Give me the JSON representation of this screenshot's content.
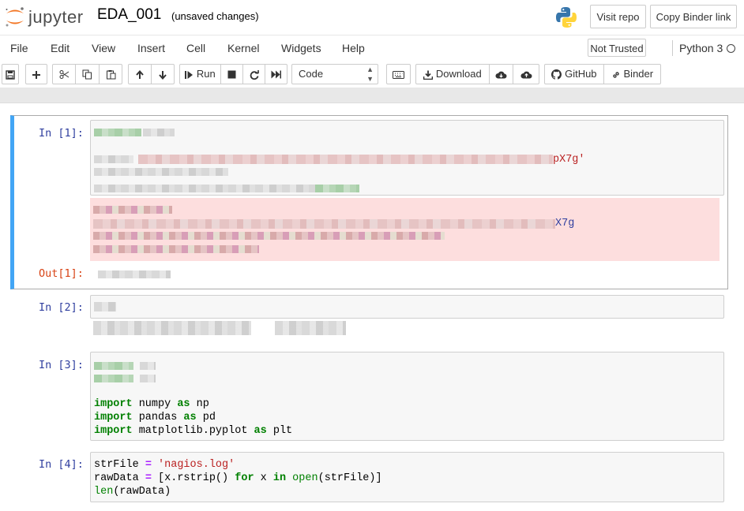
{
  "header": {
    "logo_text": "jupyter",
    "notebook_name": "EDA_001",
    "autosave_status": "(unsaved changes)",
    "visit_repo": "Visit repo",
    "copy_binder_link": "Copy Binder link"
  },
  "menubar": {
    "items": [
      "File",
      "Edit",
      "View",
      "Insert",
      "Cell",
      "Kernel",
      "Widgets",
      "Help"
    ],
    "trust_status": "Not Trusted",
    "kernel_name": "Python 3"
  },
  "toolbar": {
    "run_label": "Run",
    "cell_type": "Code",
    "download_label": "Download",
    "github_label": "GitHub",
    "binder_label": "Binder"
  },
  "cells": [
    {
      "prompt": "In [1]:",
      "output_prompt": "Out[1]:",
      "visible_fragment_1": "pX7g'",
      "visible_fragment_2": "X7g"
    },
    {
      "prompt": "In [2]:"
    },
    {
      "prompt": "In [3]:",
      "code": [
        {
          "kw": "import",
          "rest": " numpy ",
          "kw2": "as",
          "rest2": " np"
        },
        {
          "kw": "import",
          "rest": " pandas ",
          "kw2": "as",
          "rest2": " pd"
        },
        {
          "kw": "import",
          "rest": " matplotlib.pyplot ",
          "kw2": "as",
          "rest2": " plt"
        }
      ]
    },
    {
      "prompt": "In [4]:",
      "code": {
        "line1_a": "strFile ",
        "line1_op": "=",
        "line1_str": " 'nagios.log'",
        "line2_a": "rawData ",
        "line2_op": "=",
        "line2_b": " [x.rstrip() ",
        "line2_kw": "for",
        "line2_c": " x ",
        "line2_kw2": "in",
        "line2_bi": " open",
        "line2_d": "(strFile)]",
        "line3_bi": "len",
        "line3_a": "(rawData)"
      }
    }
  ],
  "colors": {
    "accent_selected": "#42a5f5",
    "input_prompt": "#303f9f",
    "output_prompt": "#d84315"
  }
}
